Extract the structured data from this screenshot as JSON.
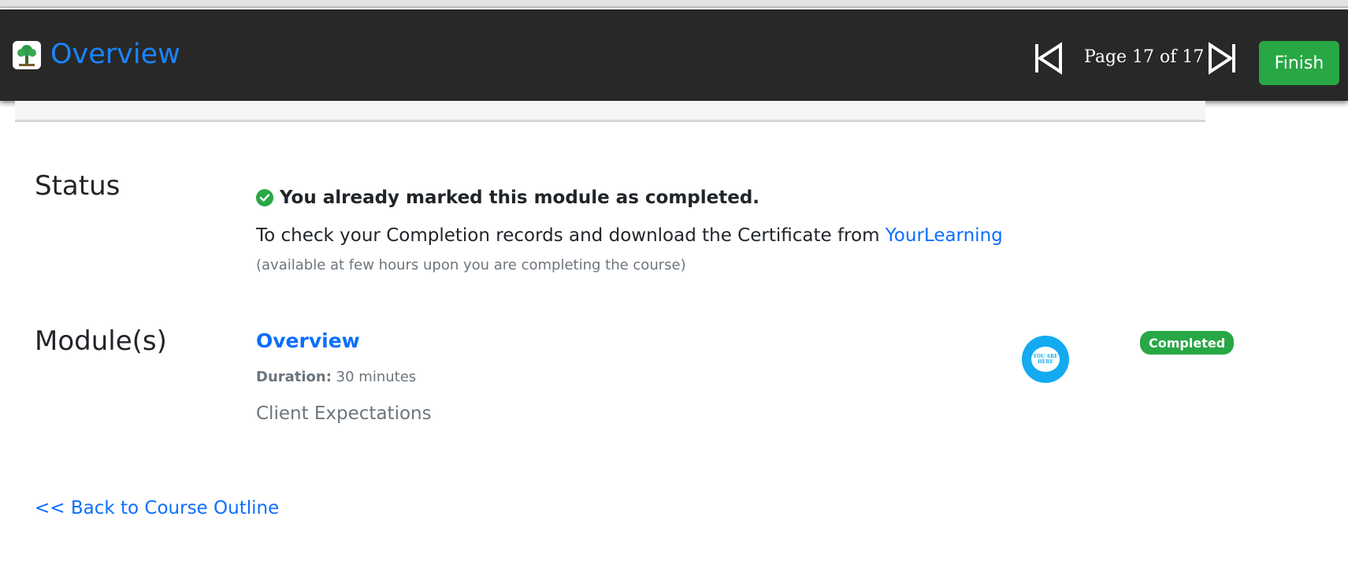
{
  "header": {
    "title": "Overview",
    "page_indicator": "Page 17 of 17",
    "finish_label": "Finish"
  },
  "status": {
    "label": "Status",
    "completed_message": "You already marked this module as completed.",
    "check_text": "To check your Completion records and download the Certificate from ",
    "link_text": "YourLearning",
    "note": "(available at few hours upon you are completing the course)"
  },
  "modules": {
    "label": "Module(s)",
    "items": [
      {
        "title": "Overview",
        "duration_label": "Duration:",
        "duration_value": "30 minutes",
        "description": "Client Expectations",
        "badge": "Completed",
        "marker_text": [
          "YOU ARE",
          "HERE"
        ]
      }
    ]
  },
  "footer": {
    "back_link": "<< Back to Course Outline"
  },
  "colors": {
    "header_bg": "#282828",
    "accent": "#1a85ff",
    "link": "#0d6efd",
    "success": "#28a745",
    "marker": "#14aaf0"
  }
}
